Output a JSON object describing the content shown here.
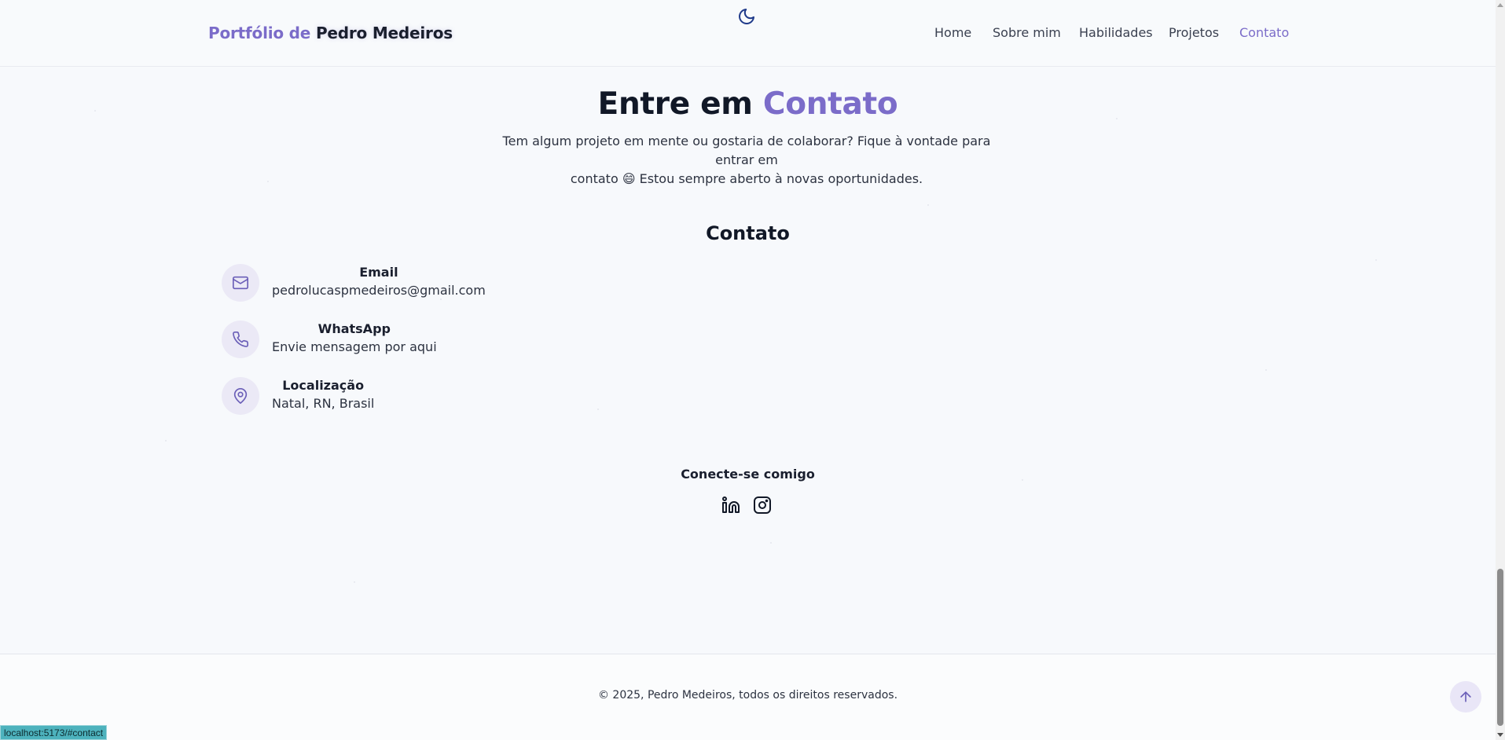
{
  "header": {
    "logo_prefix": "Portfólio de",
    "logo_name": "Pedro Medeiros",
    "theme_icon": "moon-icon",
    "nav": [
      {
        "label": "Home",
        "active": false
      },
      {
        "label": "Sobre mim",
        "active": false
      },
      {
        "label": "Habilidades",
        "active": false
      },
      {
        "label": "Projetos",
        "active": false
      },
      {
        "label": "Contato",
        "active": true
      }
    ]
  },
  "section": {
    "title_prefix": "Entre em",
    "title_accent": "Contato",
    "subtitle_line1": "Tem algum projeto em mente ou gostaria de colaborar? Fique à vontade para entrar em",
    "subtitle_line2": "contato 😄 Estou sempre aberto à novas oportunidades."
  },
  "contact": {
    "heading": "Contato",
    "items": [
      {
        "icon": "mail-icon",
        "label": "Email",
        "value": "pedrolucaspmedeiros@gmail.com"
      },
      {
        "icon": "phone-icon",
        "label": "WhatsApp",
        "value": "Envie mensagem por aqui"
      },
      {
        "icon": "map-pin-icon",
        "label": "Localização",
        "value": "Natal, RN, Brasil"
      }
    ]
  },
  "connect": {
    "title": "Conecte-se comigo",
    "links": [
      {
        "icon": "linkedin-icon"
      },
      {
        "icon": "instagram-icon"
      }
    ]
  },
  "footer": {
    "copyright": "© 2025, Pedro Medeiros, todos os direitos reservados.",
    "back_to_top_icon": "arrow-up-icon"
  },
  "status_bar": {
    "url": "localhost:5173/#contact"
  },
  "colors": {
    "accent": "#7b6cc9",
    "background": "#f7f9fc",
    "text": "#1a1f2e"
  }
}
